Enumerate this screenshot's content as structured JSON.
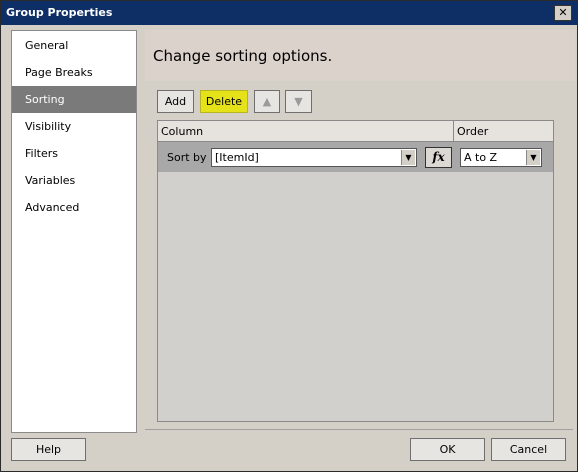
{
  "window": {
    "title": "Group Properties",
    "close_label": "✕"
  },
  "sidebar": {
    "items": [
      {
        "label": "General"
      },
      {
        "label": "Page Breaks"
      },
      {
        "label": "Sorting"
      },
      {
        "label": "Visibility"
      },
      {
        "label": "Filters"
      },
      {
        "label": "Variables"
      },
      {
        "label": "Advanced"
      }
    ],
    "selected": "Sorting"
  },
  "header": {
    "title": "Change sorting options."
  },
  "toolbar": {
    "add_label": "Add",
    "delete_label": "Delete",
    "up_icon": "▲",
    "down_icon": "▼"
  },
  "grid": {
    "columns": [
      "Column",
      "Order"
    ],
    "rows": [
      {
        "prefix": "Sort by",
        "field": "[ItemId]",
        "order": "A to Z"
      }
    ]
  },
  "fx_label": "fx",
  "footer": {
    "help_label": "Help",
    "ok_label": "OK",
    "cancel_label": "Cancel"
  },
  "colors": {
    "titlebar": "#0d2f66",
    "highlight_delete": "#e5e21a",
    "selected_nav": "#7a7a7a"
  }
}
